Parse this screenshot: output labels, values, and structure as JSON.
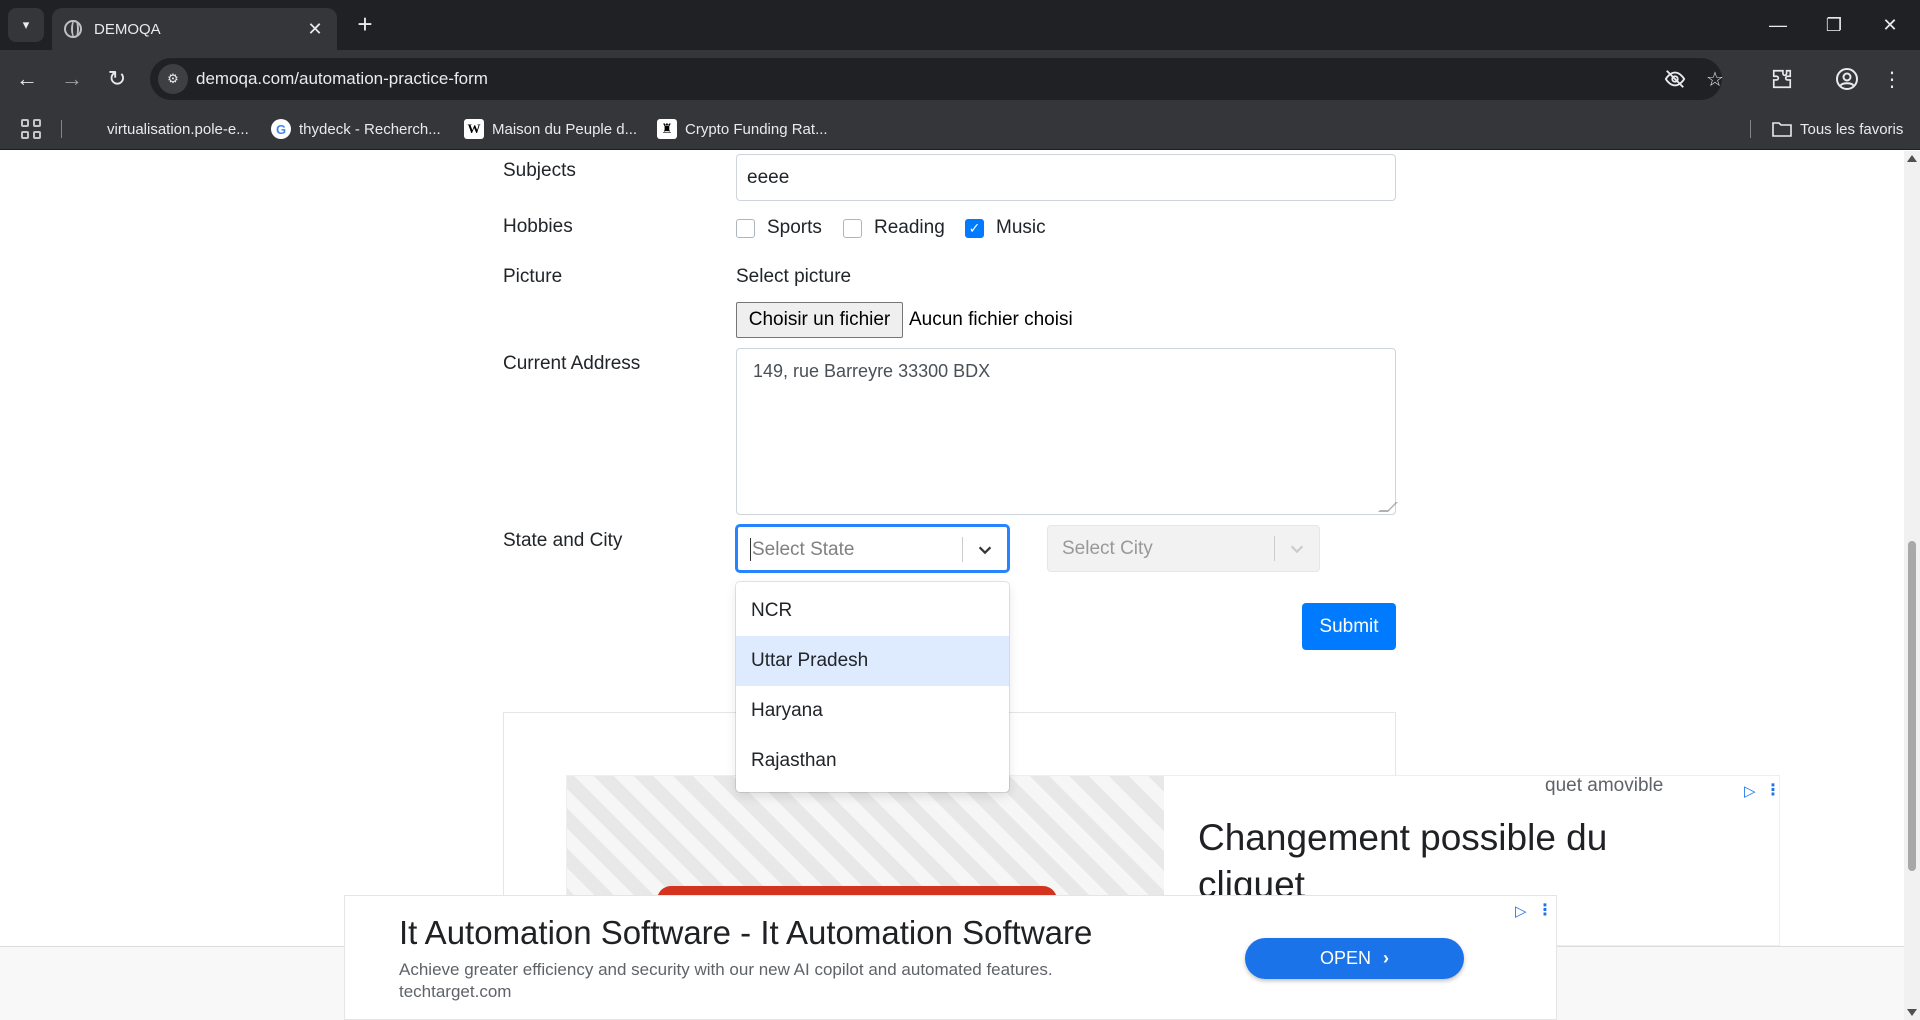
{
  "browser": {
    "tab_title": "DEMOQA",
    "url": "demoqa.com/automation-practice-form",
    "bookmarks": [
      {
        "label": "virtualisation.pole-e..."
      },
      {
        "label": "thydeck - Recherch..."
      },
      {
        "label": "Maison du Peuple d..."
      },
      {
        "label": "Crypto Funding Rat..."
      }
    ],
    "all_bookmarks_label": "Tous les favoris"
  },
  "form": {
    "subjects_label": "Subjects",
    "subjects_value": "eeee",
    "hobbies_label": "Hobbies",
    "hobbies": [
      {
        "label": "Sports",
        "checked": false
      },
      {
        "label": "Reading",
        "checked": false
      },
      {
        "label": "Music",
        "checked": true
      }
    ],
    "picture_label": "Picture",
    "picture_hint": "Select picture",
    "file_button": "Choisir un fichier",
    "file_status": "Aucun fichier choisi",
    "address_label": "Current Address",
    "address_value": "149, rue Barreyre 33300 BDX",
    "state_city_label": "State and City",
    "state_placeholder": "Select State",
    "city_placeholder": "Select City",
    "state_options": [
      "NCR",
      "Uttar Pradesh",
      "Haryana",
      "Rajasthan"
    ],
    "focused_option": "Uttar Pradesh",
    "submit_label": "Submit"
  },
  "ads": {
    "ad1_title": "Changement possible du cliquet",
    "ad1_sub": "quet amovible",
    "ad2_title": "It Automation Software - It Automation Software",
    "ad2_desc": "Achieve greater efficiency and security with our new AI copilot and automated features.",
    "ad2_site": "techtarget.com",
    "ad2_cta": "OPEN"
  },
  "colors": {
    "accent": "#007bff",
    "focus": "#2684ff",
    "option_focus_bg": "#deebff",
    "ad_blue": "#1a73e8"
  }
}
